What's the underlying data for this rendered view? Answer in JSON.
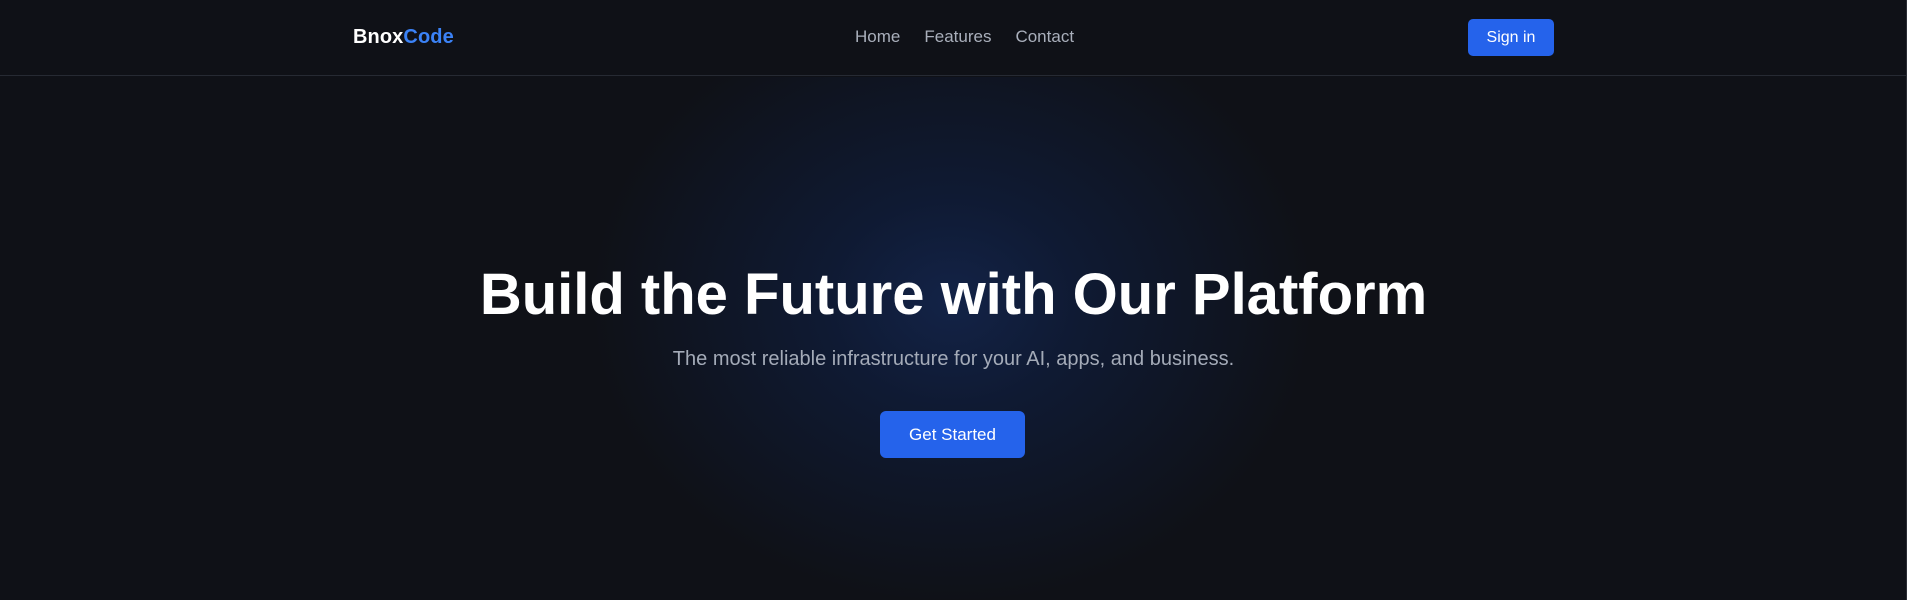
{
  "header": {
    "logo_part1": "Bnox",
    "logo_part2": "Code",
    "nav": {
      "home": "Home",
      "features": "Features",
      "contact": "Contact"
    },
    "signin_label": "Sign in"
  },
  "hero": {
    "title": "Build the Future with Our Platform",
    "subtitle": "The most reliable infrastructure for your AI, apps, and business.",
    "cta_label": "Get Started"
  },
  "colors": {
    "background": "#0f1117",
    "accent": "#2563eb",
    "logo_accent": "#3b82f6",
    "text_primary": "#ffffff",
    "text_muted": "#a9afbb"
  }
}
